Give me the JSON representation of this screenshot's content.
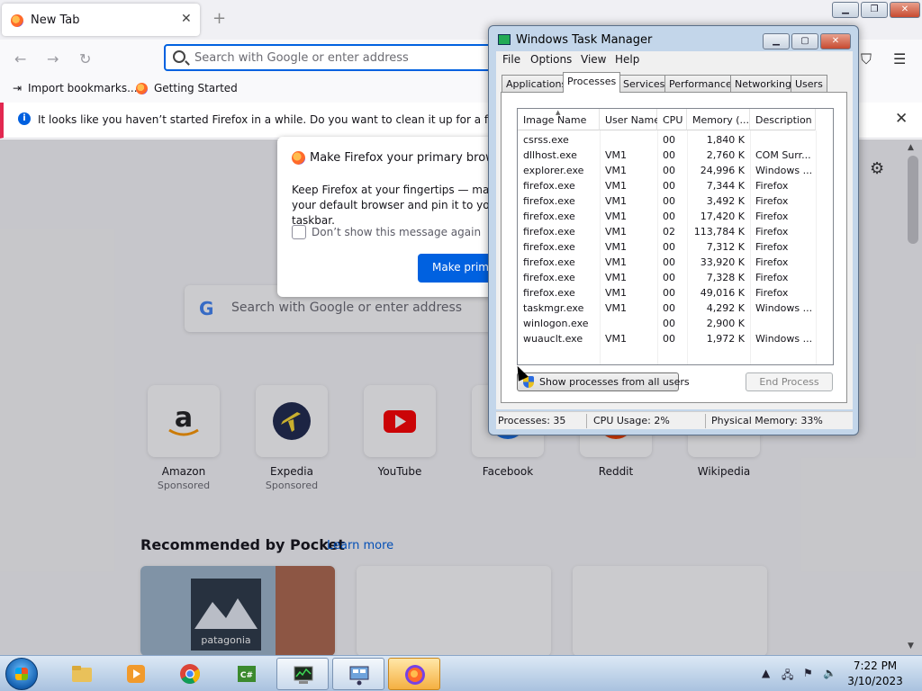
{
  "firefox": {
    "tab_title": "New Tab",
    "tab_close": "✕",
    "new_tab": "+",
    "url_placeholder": "Search with Google or enter address",
    "bookmarks": [
      "Import bookmarks...",
      "Getting Started"
    ],
    "notification": "It looks like you haven’t started Firefox in a while. Do you want to clean it up for a fresh, like-new experience?",
    "dialog": {
      "title": "Make Firefox your primary browser?",
      "body": "Keep Firefox at your fingertips — make it your default browser and pin it to your taskbar.",
      "checkbox_label": "Don’t show this message again",
      "primary_button": "Make primary browser"
    },
    "content_search_placeholder": "Search with Google or enter address",
    "top_sites": [
      {
        "name": "Amazon",
        "sub": "Sponsored"
      },
      {
        "name": "Expedia",
        "sub": "Sponsored"
      },
      {
        "name": "YouTube",
        "sub": ""
      },
      {
        "name": "Facebook",
        "sub": ""
      },
      {
        "name": "Reddit",
        "sub": ""
      },
      {
        "name": "Wikipedia",
        "sub": ""
      }
    ],
    "pocket_heading": "Recommended by Pocket",
    "pocket_link": "Learn more",
    "pocket_card_text": "patagonia"
  },
  "taskmgr": {
    "title": "Windows Task Manager",
    "menu": [
      "File",
      "Options",
      "View",
      "Help"
    ],
    "tabs": [
      "Applications",
      "Processes",
      "Services",
      "Performance",
      "Networking",
      "Users"
    ],
    "active_tab": "Processes",
    "columns": [
      "Image Name",
      "User Name",
      "CPU",
      "Memory (...",
      "Description"
    ],
    "processes": [
      [
        "csrss.exe",
        "",
        "00",
        "1,840 K",
        ""
      ],
      [
        "dllhost.exe",
        "VM1",
        "00",
        "2,760 K",
        "COM Surr..."
      ],
      [
        "explorer.exe",
        "VM1",
        "00",
        "24,996 K",
        "Windows ..."
      ],
      [
        "firefox.exe",
        "VM1",
        "00",
        "7,344 K",
        "Firefox"
      ],
      [
        "firefox.exe",
        "VM1",
        "00",
        "3,492 K",
        "Firefox"
      ],
      [
        "firefox.exe",
        "VM1",
        "00",
        "17,420 K",
        "Firefox"
      ],
      [
        "firefox.exe",
        "VM1",
        "02",
        "113,784 K",
        "Firefox"
      ],
      [
        "firefox.exe",
        "VM1",
        "00",
        "7,312 K",
        "Firefox"
      ],
      [
        "firefox.exe",
        "VM1",
        "00",
        "33,920 K",
        "Firefox"
      ],
      [
        "firefox.exe",
        "VM1",
        "00",
        "7,328 K",
        "Firefox"
      ],
      [
        "firefox.exe",
        "VM1",
        "00",
        "49,016 K",
        "Firefox"
      ],
      [
        "taskmgr.exe",
        "VM1",
        "00",
        "4,292 K",
        "Windows ..."
      ],
      [
        "winlogon.exe",
        "",
        "00",
        "2,900 K",
        ""
      ],
      [
        "wuauclt.exe",
        "VM1",
        "00",
        "1,972 K",
        "Windows ..."
      ]
    ],
    "show_all_button": "Show processes from all users",
    "end_process_button": "End Process",
    "status": {
      "processes": "Processes: 35",
      "cpu": "CPU Usage: 2%",
      "memory": "Physical Memory: 33%"
    }
  },
  "taskbar": {
    "time": "7:22 PM",
    "date": "3/10/2023"
  }
}
